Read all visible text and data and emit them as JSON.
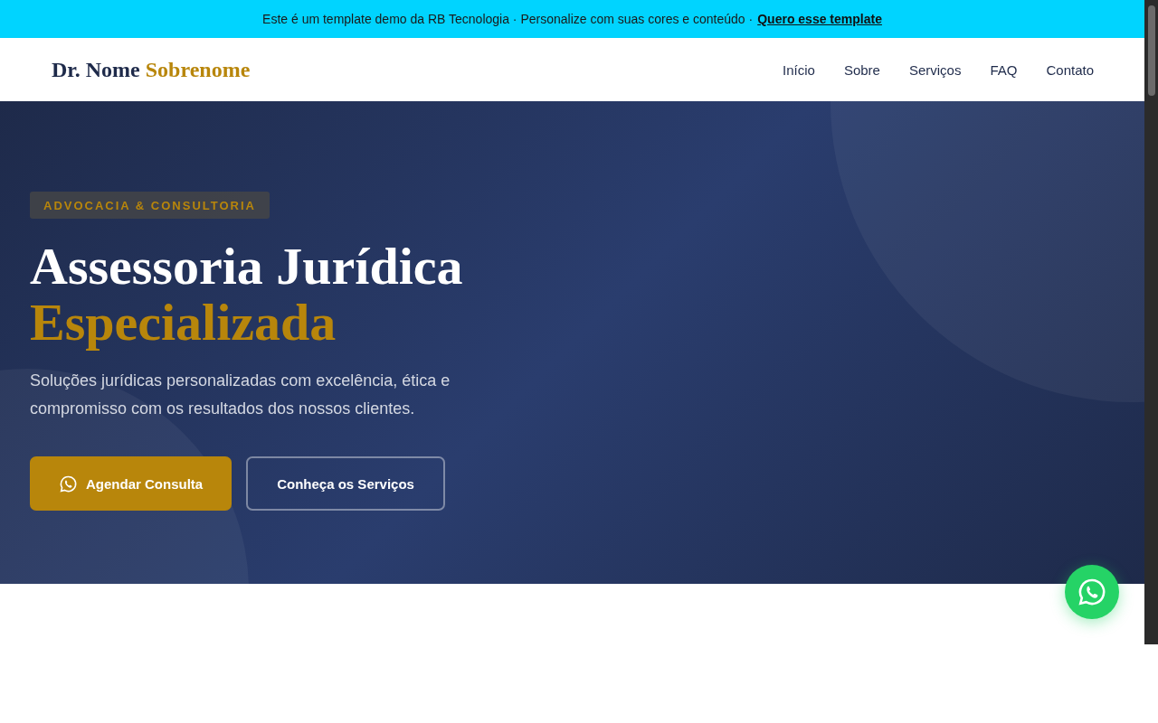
{
  "top_banner": {
    "text": "Este é um template demo da RB Tecnologia · Personalize com suas cores e conteúdo ·",
    "link": "Quero esse template"
  },
  "header": {
    "logo_name": "Dr. Nome",
    "logo_surname": "Sobrenome",
    "nav": [
      {
        "label": "Início"
      },
      {
        "label": "Sobre"
      },
      {
        "label": "Serviços"
      },
      {
        "label": "FAQ"
      },
      {
        "label": "Contato"
      }
    ]
  },
  "hero": {
    "badge": "ADVOCACIA & CONSULTORIA",
    "title_line1": "Assessoria Jurídica",
    "title_line2": "Especializada",
    "subtitle": "Soluções jurídicas personalizadas com excelência, ética e compromisso com os resultados dos nossos clientes.",
    "buttons": [
      {
        "label": "Agendar Consulta",
        "kind": "primary"
      },
      {
        "label": "Conheça os Serviços",
        "kind": "outline"
      }
    ]
  }
}
